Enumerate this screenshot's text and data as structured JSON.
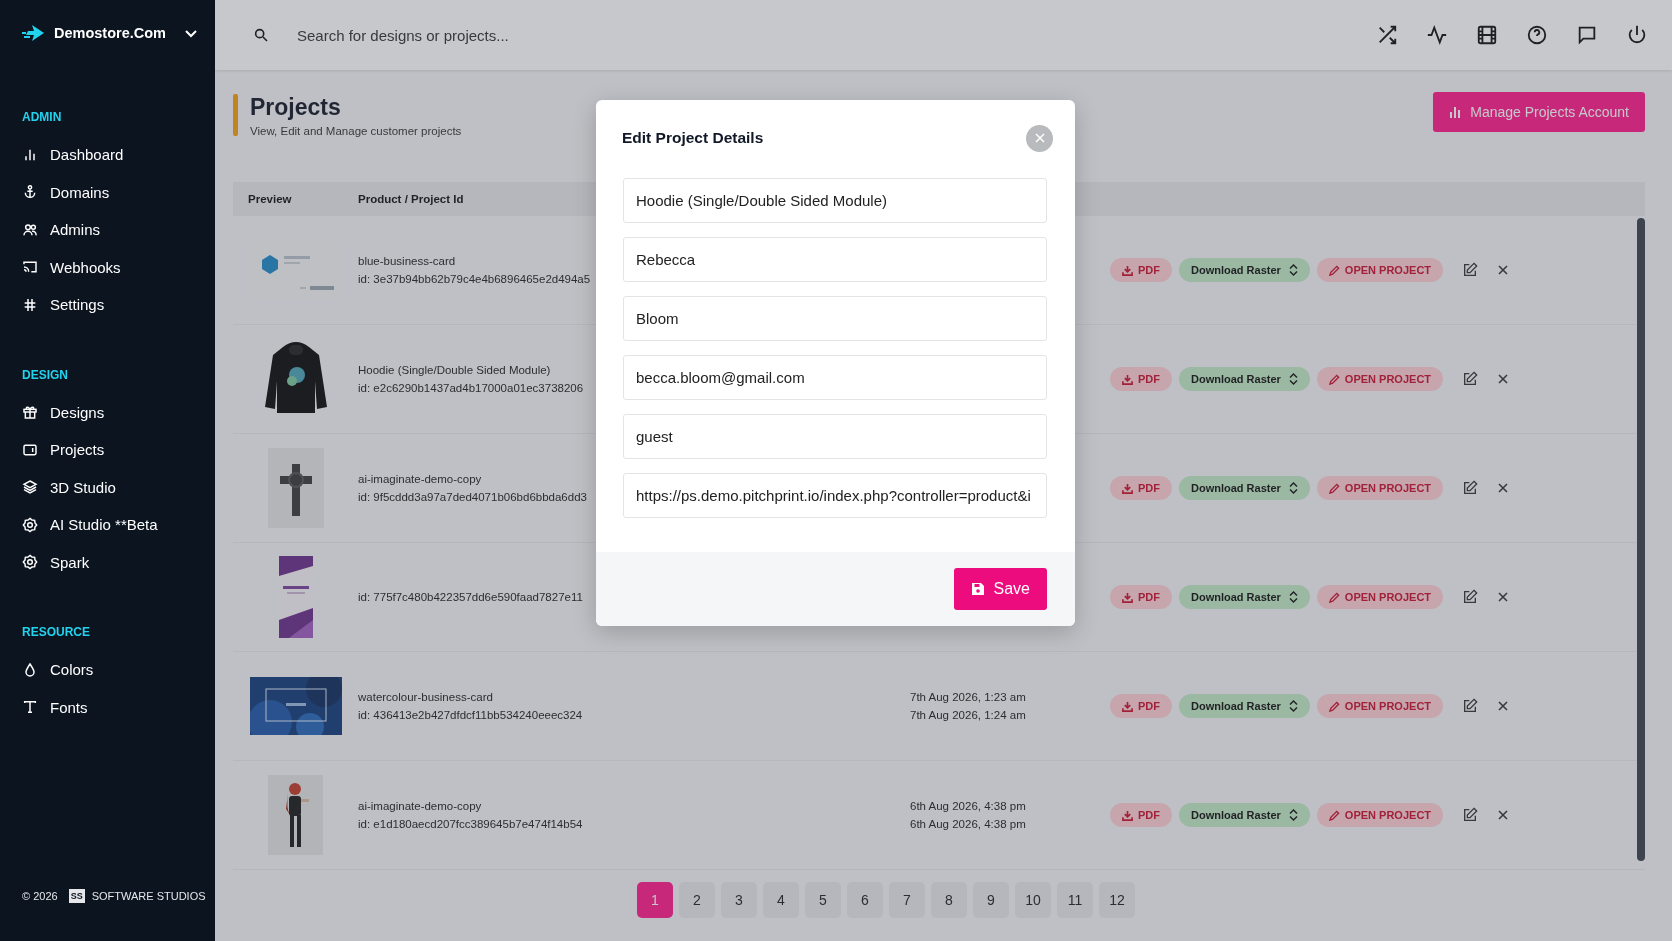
{
  "brand": {
    "name": "Demostore.Com"
  },
  "sidebar": {
    "sections": [
      {
        "title": "ADMIN",
        "items": [
          {
            "label": "Dashboard"
          },
          {
            "label": "Domains"
          },
          {
            "label": "Admins"
          },
          {
            "label": "Webhooks"
          },
          {
            "label": "Settings"
          }
        ]
      },
      {
        "title": "DESIGN",
        "items": [
          {
            "label": "Designs"
          },
          {
            "label": "Projects"
          },
          {
            "label": "3D Studio"
          },
          {
            "label": "AI Studio **Beta"
          },
          {
            "label": "Spark"
          }
        ]
      },
      {
        "title": "RESOURCE",
        "items": [
          {
            "label": "Colors"
          },
          {
            "label": "Fonts"
          }
        ]
      }
    ]
  },
  "footer": {
    "copyright": "© 2026",
    "logo_text": "SS",
    "company": "SOFTWARE STUDIOS"
  },
  "search": {
    "placeholder": "Search for designs or projects..."
  },
  "header": {
    "title": "Projects",
    "subtitle": "View, Edit and Manage customer projects",
    "action_button": "Manage Projects Account"
  },
  "table": {
    "columns": [
      "Preview",
      "Product / Project Id"
    ],
    "rows": [
      {
        "name": "blue-business-card",
        "id": "id: 3e37b94bb62b79c4e4b6896465e2d494a5",
        "pdf": "PDF",
        "raster": "Download Raster",
        "open": "OPEN PROJECT"
      },
      {
        "name": "Hoodie (Single/Double Sided Module)",
        "id": "id: e2c6290b1437ad4b17000a01ec3738206",
        "pdf": "PDF",
        "raster": "Download Raster",
        "open": "OPEN PROJECT"
      },
      {
        "name": "ai-imaginate-demo-copy",
        "id": "id: 9f5cddd3a97a7ded4071b06bd6bbda6dd3",
        "pdf": "PDF",
        "raster": "Download Raster",
        "open": "OPEN PROJECT"
      },
      {
        "id": "id: 775f7c480b422357dd6e590faad7827e11",
        "pdf": "PDF",
        "raster": "Download Raster",
        "open": "OPEN PROJECT"
      },
      {
        "name": "watercolour-business-card",
        "id": "id: 436413e2b427dfdcf11bb534240eeec324",
        "dates": [
          "7th Aug 2026, 1:23 am",
          "7th Aug 2026, 1:24 am"
        ],
        "pdf": "PDF",
        "raster": "Download Raster",
        "open": "OPEN PROJECT"
      },
      {
        "name": "ai-imaginate-demo-copy",
        "id": "id: e1d180aecd207fcc389645b7e474f14b54",
        "dates": [
          "6th Aug 2026, 4:38 pm",
          "6th Aug 2026, 4:38 pm"
        ],
        "pdf": "PDF",
        "raster": "Download Raster",
        "open": "OPEN PROJECT"
      }
    ]
  },
  "pagination": [
    {
      "label": "1",
      "selected": true
    },
    {
      "label": "2",
      "selected": false
    },
    {
      "label": "3",
      "selected": false
    },
    {
      "label": "4",
      "selected": false
    },
    {
      "label": "5",
      "selected": false
    },
    {
      "label": "6",
      "selected": false
    },
    {
      "label": "7",
      "selected": false
    },
    {
      "label": "8",
      "selected": false
    },
    {
      "label": "9",
      "selected": false
    },
    {
      "label": "10",
      "selected": false
    },
    {
      "label": "11",
      "selected": false
    },
    {
      "label": "12",
      "selected": false
    }
  ],
  "modal": {
    "title": "Edit Project Details",
    "fields": [
      "Hoodie (Single/Double Sided Module)",
      "Rebecca",
      "Bloom",
      "becca.bloom@gmail.com",
      "guest",
      "https://ps.demo.pitchprint.io/index.php?controller=product&i"
    ],
    "save_button": "Save"
  }
}
